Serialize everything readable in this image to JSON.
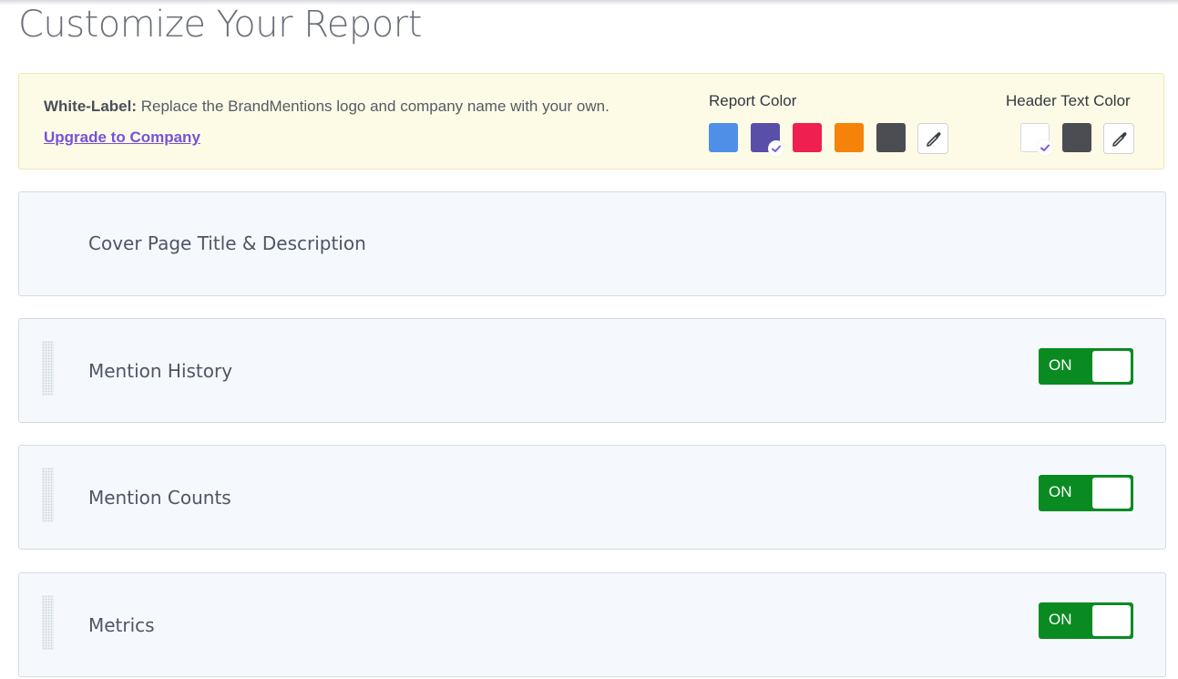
{
  "page": {
    "title": "Customize Your Report"
  },
  "white_label": {
    "bold_label": "White-Label:",
    "description": " Replace the BrandMentions logo and company name with your own.",
    "upgrade_link": "Upgrade to Company"
  },
  "report_color": {
    "label": "Report Color",
    "swatches": [
      {
        "color": "#4f8fe8",
        "selected": false
      },
      {
        "color": "#5a4fa8",
        "selected": true
      },
      {
        "color": "#ef1f4f",
        "selected": false
      },
      {
        "color": "#f58309",
        "selected": false
      },
      {
        "color": "#4b4d53",
        "selected": false
      }
    ],
    "picker_icon": "eyedropper-icon"
  },
  "header_text_color": {
    "label": "Header Text Color",
    "swatches": [
      {
        "color": "#ffffff",
        "selected": true
      },
      {
        "color": "#4b4d53",
        "selected": false
      }
    ],
    "picker_icon": "eyedropper-icon"
  },
  "sections": [
    {
      "title": "Cover Page Title & Description"
    },
    {
      "title": "Mention History",
      "toggle": "ON",
      "enabled": true
    },
    {
      "title": "Mention Counts",
      "toggle": "ON",
      "enabled": true
    },
    {
      "title": "Metrics",
      "toggle": "ON",
      "enabled": true
    }
  ],
  "colors": {
    "accent": "#7752d8",
    "toggle_on": "#0a8b22",
    "check": "#7b57e0"
  }
}
